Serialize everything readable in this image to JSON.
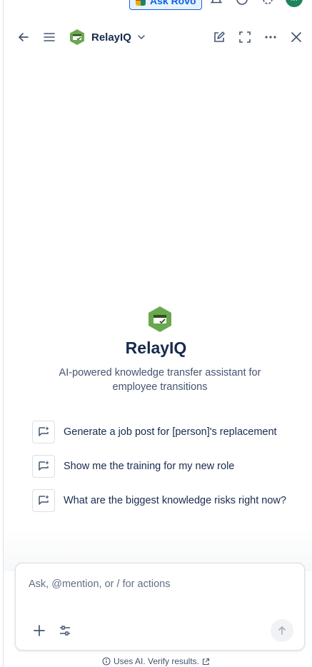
{
  "topbar": {
    "ask_label": "Ask Rovo",
    "avatar_initials": "M"
  },
  "header": {
    "app_name": "RelayIQ"
  },
  "hero": {
    "title": "RelayIQ",
    "subtitle": "AI-powered knowledge transfer assistant for employee transitions"
  },
  "suggestions": [
    {
      "text": "Generate a job post for [person]'s replacement"
    },
    {
      "text": "Show me the training for my new role"
    },
    {
      "text": "What are the biggest knowledge risks right now?"
    }
  ],
  "composer": {
    "placeholder": "Ask, @mention, or / for actions"
  },
  "footer": {
    "notice": "Uses AI. Verify results."
  },
  "colors": {
    "brand_green": "#6aa84f",
    "link_blue": "#0c66e4"
  }
}
